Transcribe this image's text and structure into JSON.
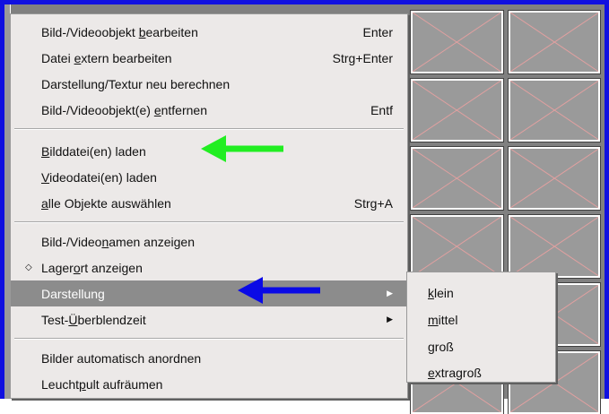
{
  "menu": {
    "items": [
      {
        "pre": "Bild-/Videoobjekt ",
        "u": "b",
        "post": "earbeiten",
        "accel": "Enter"
      },
      {
        "pre": "Datei ",
        "u": "e",
        "post": "xtern bearbeiten",
        "accel": "Strg+Enter"
      },
      {
        "pre": "Darstellung/Textur neu berechnen",
        "u": "",
        "post": "",
        "accel": ""
      },
      {
        "pre": "Bild-/Videoobjekt(e) ",
        "u": "e",
        "post": "ntfernen",
        "accel": "Entf"
      },
      {
        "pre": "",
        "u": "B",
        "post": "ilddatei(en) laden",
        "accel": ""
      },
      {
        "pre": "",
        "u": "V",
        "post": "ideodatei(en) laden",
        "accel": ""
      },
      {
        "pre": "",
        "u": "a",
        "post": "lle Objekte auswählen",
        "accel": "Strg+A"
      },
      {
        "pre": "Bild-/Video",
        "u": "n",
        "post": "amen anzeigen",
        "accel": ""
      },
      {
        "pre": "Lager",
        "u": "o",
        "post": "rt anzeigen",
        "accel": ""
      },
      {
        "pre": "Darstellung",
        "u": "",
        "post": "",
        "accel": ""
      },
      {
        "pre": "Test-",
        "u": "Ü",
        "post": "berblendzeit",
        "accel": ""
      },
      {
        "pre": "Bilder automatisch anordnen",
        "u": "",
        "post": "",
        "accel": ""
      },
      {
        "pre": "Leucht",
        "u": "p",
        "post": "ult aufräumen",
        "accel": ""
      }
    ],
    "submenu_arrow": "▶",
    "bullet": "◇"
  },
  "submenu": {
    "items": [
      {
        "u": "k",
        "post": "lein"
      },
      {
        "u": "m",
        "post": "ittel"
      },
      {
        "u": "g",
        "post": "roß"
      },
      {
        "u": "e",
        "post": "xtragroß"
      }
    ]
  },
  "colors": {
    "frame": "#1010e0",
    "menu_bg": "#ece9e8",
    "highlight": "#8c8c8c",
    "green_arrow": "#22ee22",
    "blue_arrow": "#0a0ae6"
  },
  "icons": {
    "thumbnail": "placeholder-cross-icon",
    "green_arrow": "arrow-left-icon",
    "blue_arrow": "arrow-left-icon"
  }
}
